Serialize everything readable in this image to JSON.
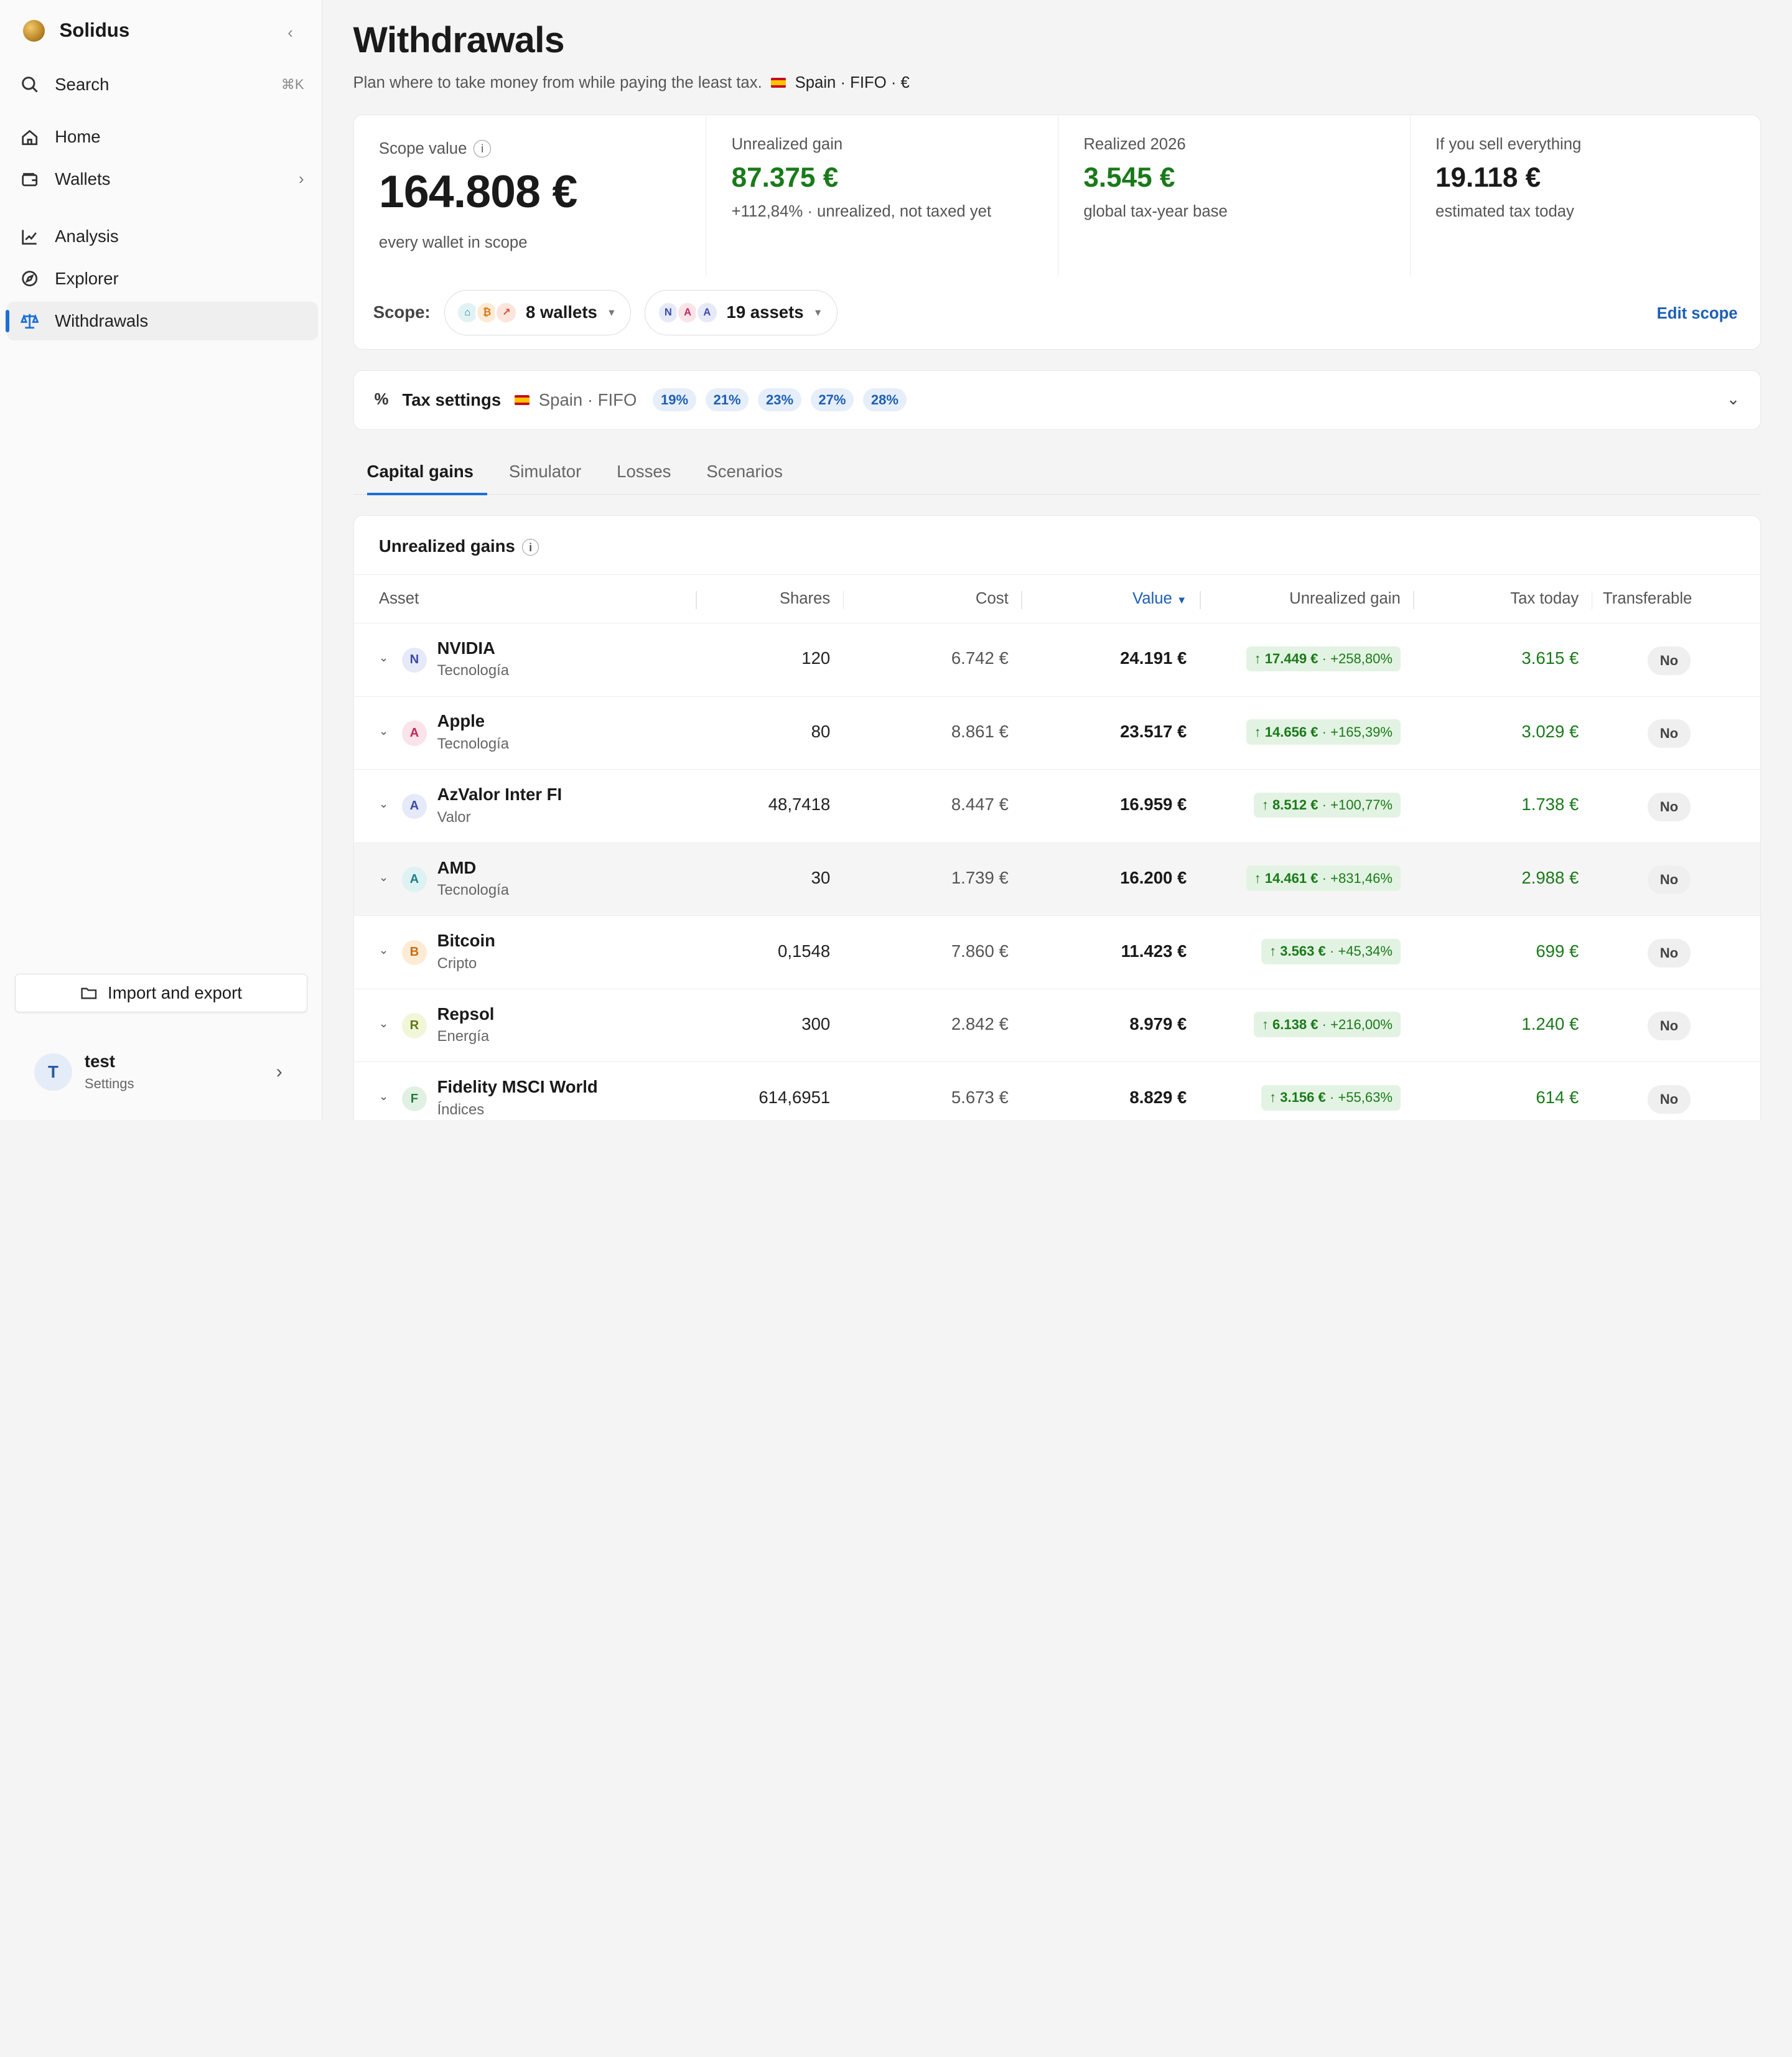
{
  "sidebar": {
    "brand": "Solidus",
    "search": {
      "label": "Search",
      "shortcut": "⌘K"
    },
    "items": [
      {
        "label": "Home",
        "icon": "home-icon"
      },
      {
        "label": "Wallets",
        "icon": "wallet-icon"
      },
      {
        "label": "Analysis",
        "icon": "chart-line-icon"
      },
      {
        "label": "Explorer",
        "icon": "compass-icon"
      },
      {
        "label": "Withdrawals",
        "icon": "scale-icon",
        "active": true
      }
    ],
    "import_export": "Import and export",
    "user": {
      "initial": "T",
      "name": "test",
      "sub": "Settings"
    }
  },
  "header": {
    "title": "Withdrawals",
    "subtitle": "Plan where to take money from while paying the least tax.",
    "region": "Spain · FIFO · €"
  },
  "summary": {
    "scope_value": {
      "label": "Scope value",
      "value": "164.808 €",
      "note": "every wallet in scope"
    },
    "unrealized": {
      "label": "Unrealized gain",
      "value": "87.375 €",
      "note": "+112,84% · unrealized, not taxed yet"
    },
    "realized": {
      "label": "Realized 2026",
      "value": "3.545 €",
      "note": "global tax-year base"
    },
    "sell_all": {
      "label": "If you sell everything",
      "value": "19.118 €",
      "note": "estimated tax today"
    },
    "scope_label": "Scope:",
    "wallets_pill": "8 wallets",
    "assets_pill": "19 assets",
    "asset_initials": [
      "N",
      "A",
      "A"
    ],
    "edit_scope": "Edit scope"
  },
  "tax": {
    "title": "Tax settings",
    "region": "Spain · FIFO",
    "rates": [
      "19%",
      "21%",
      "23%",
      "27%",
      "28%"
    ]
  },
  "tabs": [
    "Capital gains",
    "Simulator",
    "Losses",
    "Scenarios"
  ],
  "gains": {
    "title": "Unrealized gains",
    "columns": {
      "asset": "Asset",
      "shares": "Shares",
      "cost": "Cost",
      "value": "Value",
      "gain": "Unrealized gain",
      "tax": "Tax today",
      "transferable": "Transferable"
    },
    "rows": [
      {
        "initial": "N",
        "name": "NVIDIA",
        "cat": "Tecnología",
        "shares": "120",
        "cost": "6.742 €",
        "value": "24.191 €",
        "gain": "↑ 17.449 €",
        "pct": " · +258,80%",
        "tax": "3.615 €",
        "transferable": "No"
      },
      {
        "initial": "A",
        "name": "Apple",
        "cat": "Tecnología",
        "shares": "80",
        "cost": "8.861 €",
        "value": "23.517 €",
        "gain": "↑ 14.656 €",
        "pct": " · +165,39%",
        "tax": "3.029 €",
        "transferable": "No"
      },
      {
        "initial": "A",
        "name": "AzValor Inter FI",
        "cat": "Valor",
        "shares": "48,7418",
        "cost": "8.447 €",
        "value": "16.959 €",
        "gain": "↑ 8.512 €",
        "pct": " · +100,77%",
        "tax": "1.738 €",
        "transferable": "No"
      },
      {
        "initial": "A",
        "name": "AMD",
        "cat": "Tecnología",
        "shares": "30",
        "cost": "1.739 €",
        "value": "16.200 €",
        "gain": "↑ 14.461 €",
        "pct": " · +831,46%",
        "tax": "2.988 €",
        "transferable": "No"
      },
      {
        "initial": "B",
        "name": "Bitcoin",
        "cat": "Cripto",
        "shares": "0,1548",
        "cost": "7.860 €",
        "value": "11.423 €",
        "gain": "↑ 3.563 €",
        "pct": " · +45,34%",
        "tax": "699 €",
        "transferable": "No"
      },
      {
        "initial": "R",
        "name": "Repsol",
        "cat": "Energía",
        "shares": "300",
        "cost": "2.842 €",
        "value": "8.979 €",
        "gain": "↑ 6.138 €",
        "pct": " · +216,00%",
        "tax": "1.240 €",
        "transferable": "No"
      },
      {
        "initial": "F",
        "name": "Fidelity MSCI World",
        "cat": "Índices",
        "shares": "614,6951",
        "cost": "5.673 €",
        "value": "8.829 €",
        "gain": "↑ 3.156 €",
        "pct": " · +55,63%",
        "tax": "614 €",
        "transferable": "No"
      }
    ]
  }
}
